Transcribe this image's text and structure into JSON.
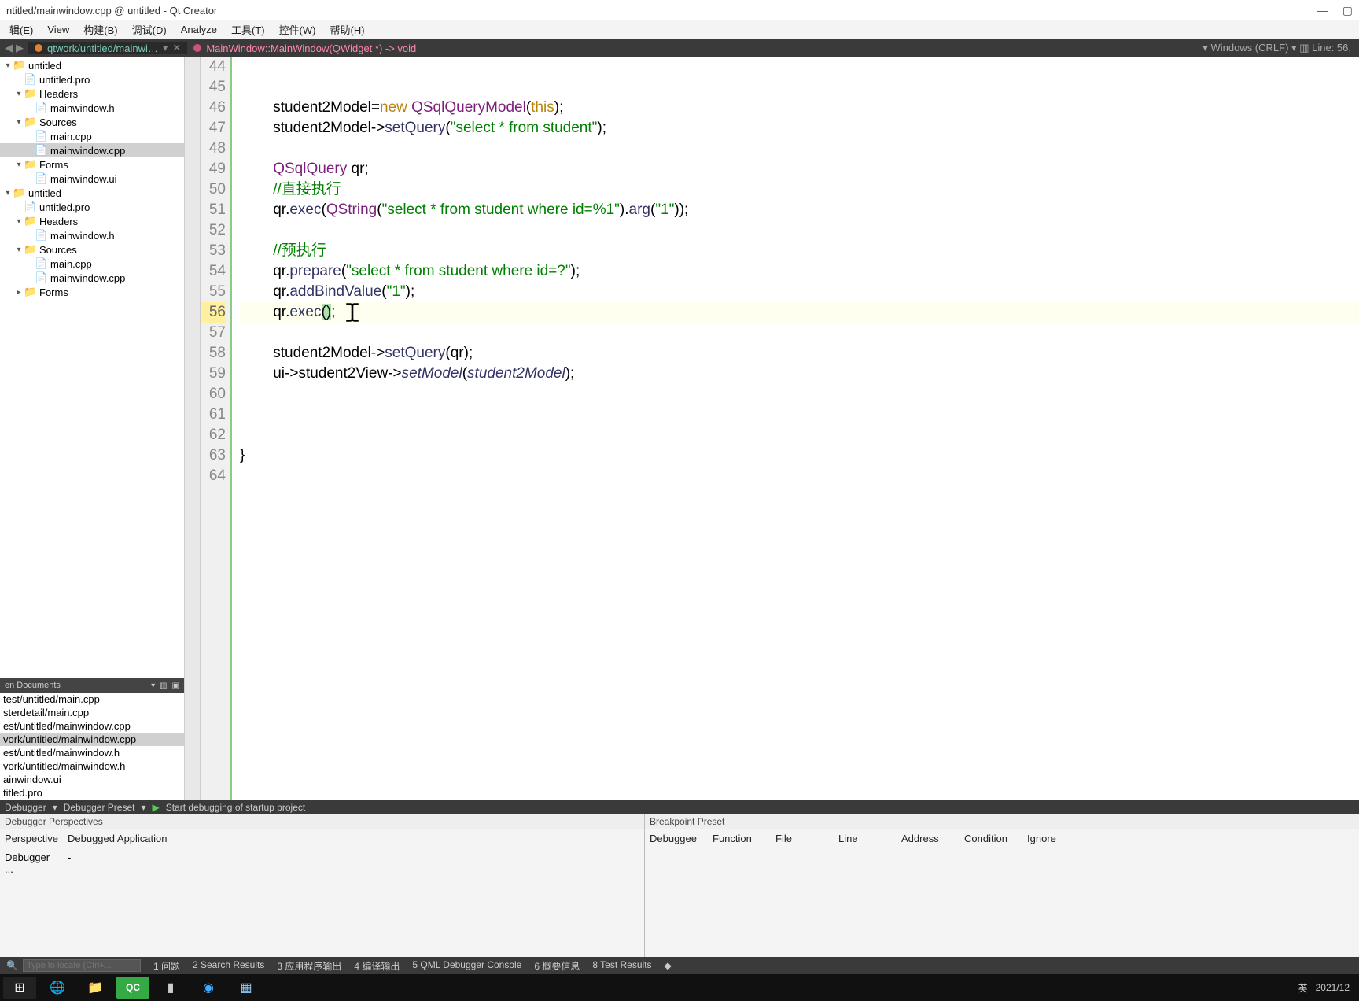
{
  "window": {
    "title": "ntitled/mainwindow.cpp @ untitled - Qt Creator"
  },
  "menu": [
    "辑(E)",
    "View",
    "构建(B)",
    "调试(D)",
    "Analyze",
    "工具(T)",
    "控件(W)",
    "帮助(H)"
  ],
  "toolbar": {
    "file_tab": "qtwork/untitled/mainwi…",
    "symbol": "MainWindow::MainWindow(QWidget *) -> void",
    "encoding": "Windows (CRLF)",
    "linecol": "Line: 56, "
  },
  "tree": [
    {
      "indent": 0,
      "chev": "▾",
      "icon": "📁",
      "label": "untitled",
      "sel": false
    },
    {
      "indent": 1,
      "chev": "",
      "icon": "📄",
      "label": "untitled.pro",
      "sel": false
    },
    {
      "indent": 1,
      "chev": "▾",
      "icon": "📁",
      "label": "Headers",
      "sel": false
    },
    {
      "indent": 2,
      "chev": "",
      "icon": "📄",
      "label": "mainwindow.h",
      "sel": false
    },
    {
      "indent": 1,
      "chev": "▾",
      "icon": "📁",
      "label": "Sources",
      "sel": false
    },
    {
      "indent": 2,
      "chev": "",
      "icon": "📄",
      "label": "main.cpp",
      "sel": false
    },
    {
      "indent": 2,
      "chev": "",
      "icon": "📄",
      "label": "mainwindow.cpp",
      "sel": true
    },
    {
      "indent": 1,
      "chev": "▾",
      "icon": "📁",
      "label": "Forms",
      "sel": false
    },
    {
      "indent": 2,
      "chev": "",
      "icon": "📄",
      "label": "mainwindow.ui",
      "sel": false
    },
    {
      "indent": 0,
      "chev": "▾",
      "icon": "📁",
      "label": "untitled",
      "sel": false
    },
    {
      "indent": 1,
      "chev": "",
      "icon": "📄",
      "label": "untitled.pro",
      "sel": false
    },
    {
      "indent": 1,
      "chev": "▾",
      "icon": "📁",
      "label": "Headers",
      "sel": false
    },
    {
      "indent": 2,
      "chev": "",
      "icon": "📄",
      "label": "mainwindow.h",
      "sel": false
    },
    {
      "indent": 1,
      "chev": "▾",
      "icon": "📁",
      "label": "Sources",
      "sel": false
    },
    {
      "indent": 2,
      "chev": "",
      "icon": "📄",
      "label": "main.cpp",
      "sel": false
    },
    {
      "indent": 2,
      "chev": "",
      "icon": "📄",
      "label": "mainwindow.cpp",
      "sel": false
    },
    {
      "indent": 1,
      "chev": "▸",
      "icon": "📁",
      "label": "Forms",
      "sel": false
    }
  ],
  "open_docs_header": "en Documents",
  "open_docs": [
    {
      "label": "test/untitled/main.cpp",
      "sel": false
    },
    {
      "label": "sterdetail/main.cpp",
      "sel": false
    },
    {
      "label": "est/untitled/mainwindow.cpp",
      "sel": false
    },
    {
      "label": "vork/untitled/mainwindow.cpp",
      "sel": true
    },
    {
      "label": "est/untitled/mainwindow.h",
      "sel": false
    },
    {
      "label": "vork/untitled/mainwindow.h",
      "sel": false
    },
    {
      "label": "ainwindow.ui",
      "sel": false
    },
    {
      "label": "titled.pro",
      "sel": false
    }
  ],
  "code": {
    "start": 44,
    "lines": [
      {
        "n": 44,
        "html": ""
      },
      {
        "n": 45,
        "html": ""
      },
      {
        "n": 46,
        "html": "        student2Model=<span class='kw'>new</span> <span class='type'>QSqlQueryModel</span>(<span class='kw'>this</span>);"
      },
      {
        "n": 47,
        "html": "        student2Model-><span class='func'>setQuery</span>(<span class='str'>\"select * from student\"</span>);"
      },
      {
        "n": 48,
        "html": ""
      },
      {
        "n": 49,
        "html": "        <span class='type'>QSqlQuery</span> qr;"
      },
      {
        "n": 50,
        "html": "        <span class='comment'>//直接执行</span>"
      },
      {
        "n": 51,
        "html": "        qr.<span class='func'>exec</span>(<span class='type'>QString</span>(<span class='str'>\"select * from student where id=%1\"</span>).<span class='func'>arg</span>(<span class='str'>\"1\"</span>));"
      },
      {
        "n": 52,
        "html": ""
      },
      {
        "n": 53,
        "html": "        <span class='comment'>//预执行</span>"
      },
      {
        "n": 54,
        "html": "        qr.<span class='func'>prepare</span>(<span class='str'>\"select * from student where id=?\"</span>);"
      },
      {
        "n": 55,
        "html": "        qr.<span class='func'>addBindValue</span>(<span class='str'>\"1\"</span>);"
      },
      {
        "n": 56,
        "html": "        qr.<span class='func'>exec</span><span class='paren-hl'>(</span><span class='paren-hl'>)</span>;",
        "current": true
      },
      {
        "n": 57,
        "html": ""
      },
      {
        "n": 58,
        "html": "        student2Model-><span class='func'>setQuery</span>(qr);"
      },
      {
        "n": 59,
        "html": "        ui->student2View-><span class='ital'>setModel</span>(<span class='ital'>student2Model</span>);"
      },
      {
        "n": 60,
        "html": ""
      },
      {
        "n": 61,
        "html": ""
      },
      {
        "n": 62,
        "html": ""
      },
      {
        "n": 63,
        "html": "}"
      },
      {
        "n": 64,
        "html": ""
      }
    ]
  },
  "debugger": {
    "topbar": {
      "label": "Debugger",
      "preset": "Debugger Preset",
      "start": "Start debugging of startup project"
    },
    "left_hdr": "Debugger Perspectives",
    "left_cols": [
      "Perspective",
      "Debugged Application"
    ],
    "left_row": [
      "Debugger ...",
      "-"
    ],
    "right_hdr": "Breakpoint Preset",
    "right_cols": [
      "Debuggee",
      "Function",
      "File",
      "Line",
      "Address",
      "Condition",
      "Ignore"
    ]
  },
  "bottom_tabs": {
    "locator_placeholder": "Type to locate (Ctrl+...",
    "tabs": [
      "1 问题",
      "2 Search Results",
      "3 应用程序输出",
      "4 编译输出",
      "5 QML Debugger Console",
      "6 概要信息",
      "8 Test Results"
    ]
  },
  "taskbar": {
    "tray_lang": "英",
    "tray_date": "2021/12"
  }
}
